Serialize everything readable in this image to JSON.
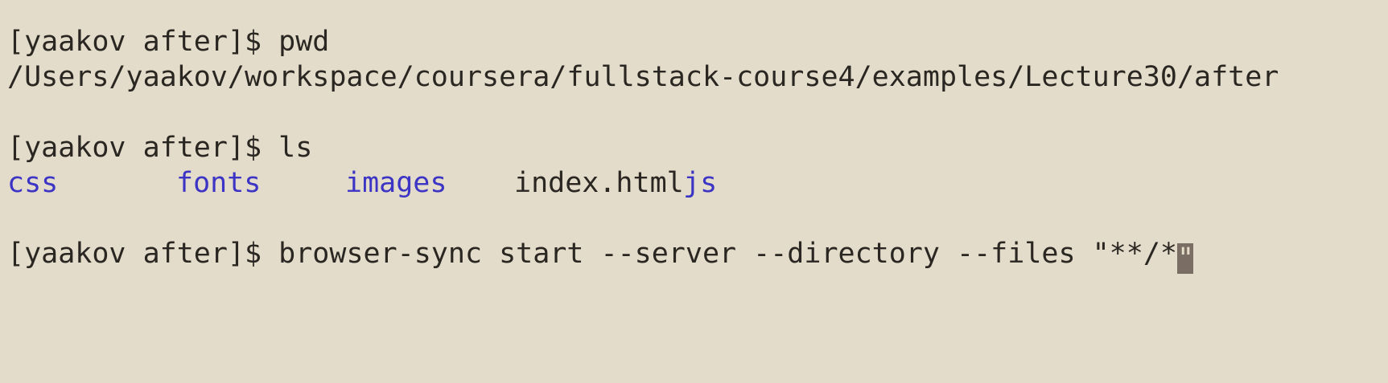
{
  "terminal": {
    "lines": [
      {
        "prompt": "[yaakov after]$ ",
        "command": "pwd"
      },
      {
        "output": "/Users/yaakov/workspace/coursera/fullstack-course4/examples/Lecture30/after"
      },
      {
        "prompt": "[yaakov after]$ ",
        "command": "ls"
      },
      {
        "prompt": "[yaakov after]$ ",
        "command": "browser-sync start --server --directory --files \"**/*",
        "cursor_char": "\""
      }
    ],
    "ls_output": [
      {
        "name": "css",
        "kind": "directory",
        "color": "#3c34c4"
      },
      {
        "name": "fonts",
        "kind": "directory",
        "color": "#3c34c4"
      },
      {
        "name": "images",
        "kind": "directory",
        "color": "#3c34c4"
      },
      {
        "name": "index.html",
        "kind": "file",
        "color": "#2a2622"
      },
      {
        "name": "js",
        "kind": "directory",
        "color": "#3c34c4"
      }
    ],
    "colors": {
      "background": "#e4dcca",
      "text": "#2a2622",
      "directory": "#3c34c4",
      "cursor": "#7a6d63"
    }
  }
}
